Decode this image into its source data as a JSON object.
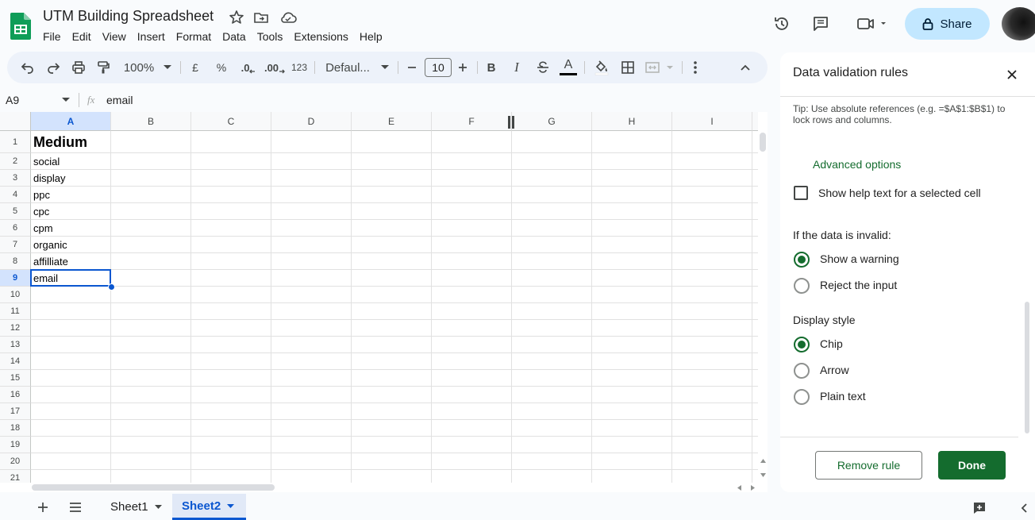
{
  "app": {
    "title": "UTM Building Spreadsheet",
    "menu": [
      "File",
      "Edit",
      "View",
      "Insert",
      "Format",
      "Data",
      "Tools",
      "Extensions",
      "Help"
    ],
    "share_label": "Share",
    "brand_color": "#0f9d58",
    "icons": [
      "sheets-logo-icon",
      "star-icon",
      "move-to-folder-icon",
      "cloud-status-icon",
      "version-history-icon",
      "comments-icon",
      "meet-icon",
      "lock-icon"
    ]
  },
  "toolbar": {
    "zoom": "100%",
    "currency": "£",
    "percent": "%",
    "decrease_decimal": ".0",
    "increase_decimal": ".00",
    "more_formats": "123",
    "font": "Defaul...",
    "font_size": "10",
    "bold": "B",
    "italic": "I",
    "text_color": "A"
  },
  "formula_bar": {
    "cell_ref": "A9",
    "fx": "fx",
    "value": "email"
  },
  "grid": {
    "columns": [
      "A",
      "B",
      "C",
      "D",
      "E",
      "F",
      "G",
      "H",
      "I"
    ],
    "rows": [
      "1",
      "2",
      "3",
      "4",
      "5",
      "6",
      "7",
      "8",
      "9",
      "10",
      "11",
      "12",
      "13",
      "14",
      "15",
      "16",
      "17",
      "18",
      "19",
      "20",
      "21"
    ],
    "column_a": [
      "Medium",
      "social",
      "display",
      "ppc",
      "cpc",
      "cpm",
      "organic",
      "affilliate",
      "email"
    ],
    "selected_cell": "A9",
    "selection_color": "#0b57d0"
  },
  "tabs": {
    "sheets": [
      "Sheet1",
      "Sheet2"
    ],
    "active": "Sheet2"
  },
  "panel": {
    "title": "Data validation rules",
    "tip": "Tip: Use absolute references (e.g. =$A$1:$B$1) to lock rows and columns.",
    "advanced_options": "Advanced options",
    "help_text_label": "Show help text for a selected cell",
    "help_text_checked": false,
    "invalid_title": "If the data is invalid:",
    "invalid_options": [
      "Show a warning",
      "Reject the input"
    ],
    "invalid_selected": "Show a warning",
    "display_title": "Display style",
    "display_options": [
      "Chip",
      "Arrow",
      "Plain text"
    ],
    "display_selected": "Chip",
    "remove_label": "Remove rule",
    "done_label": "Done",
    "accent_color": "#146c2e"
  }
}
